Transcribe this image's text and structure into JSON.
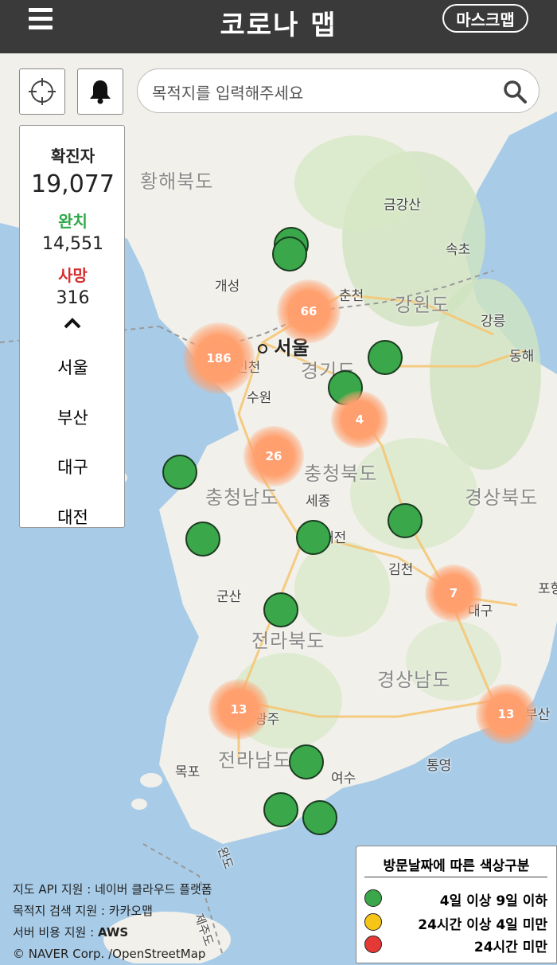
{
  "header": {
    "title": "코로나 맵",
    "mask_map_label": "마스크맵"
  },
  "search": {
    "placeholder": "목적지를 입력해주세요"
  },
  "stats": {
    "confirmed_label": "확진자",
    "confirmed_value": "19,077",
    "recovered_label": "완치",
    "recovered_value": "14,551",
    "death_label": "사망",
    "death_value": "316",
    "cities": [
      "서울",
      "부산",
      "대구",
      "대전"
    ]
  },
  "map": {
    "places": {
      "gaeseong": "개성",
      "seoul": "서울",
      "incheon": "인천",
      "suwon": "수원",
      "chuncheon": "춘천",
      "gangneung": "강릉",
      "sokcho": "속초",
      "donghae": "동해",
      "geumgangsan": "금강산",
      "sejong": "세종",
      "daejeon": "대전",
      "gimcheon": "김천",
      "gunsan": "군산",
      "daegu": "대구",
      "pohang": "포항",
      "gwangju": "광주",
      "busan": "부산",
      "mokpo": "목포",
      "yeosu": "여수",
      "tongyeong": "통영",
      "jejudo": "제주도",
      "wando": "완도"
    },
    "regions": {
      "hwanghae": "황해북도",
      "gangwon": "강원도",
      "gyeonggi": "경기도",
      "chungbuk": "충청북도",
      "chungnam": "충청남도",
      "gyeongbuk": "경상북도",
      "jeonbuk": "전라북도",
      "gyeongnam": "경상남도",
      "jeonnam": "전라남도"
    },
    "clusters": [
      "66",
      "186",
      "4",
      "26",
      "7",
      "13",
      "13"
    ]
  },
  "credits": {
    "line1_prefix": "지도 API 지원 : ",
    "line1_value": "네이버 클라우드 플랫폼",
    "line2_prefix": "목적지 검색 지원 : ",
    "line2_value": "카카오맵",
    "line3_prefix": "서버 비용 지원 : ",
    "line3_value": "AWS",
    "line4": "© NAVER Corp. /OpenStreetMap"
  },
  "legend": {
    "title": "방문날짜에 따른 색상구분",
    "items": [
      {
        "color": "#3aa84a",
        "label": "4일 이상 9일 이하"
      },
      {
        "color": "#f5c518",
        "label": "24시간 이상 4일 미만"
      },
      {
        "color": "#e53935",
        "label": "24시간 미만"
      }
    ]
  }
}
